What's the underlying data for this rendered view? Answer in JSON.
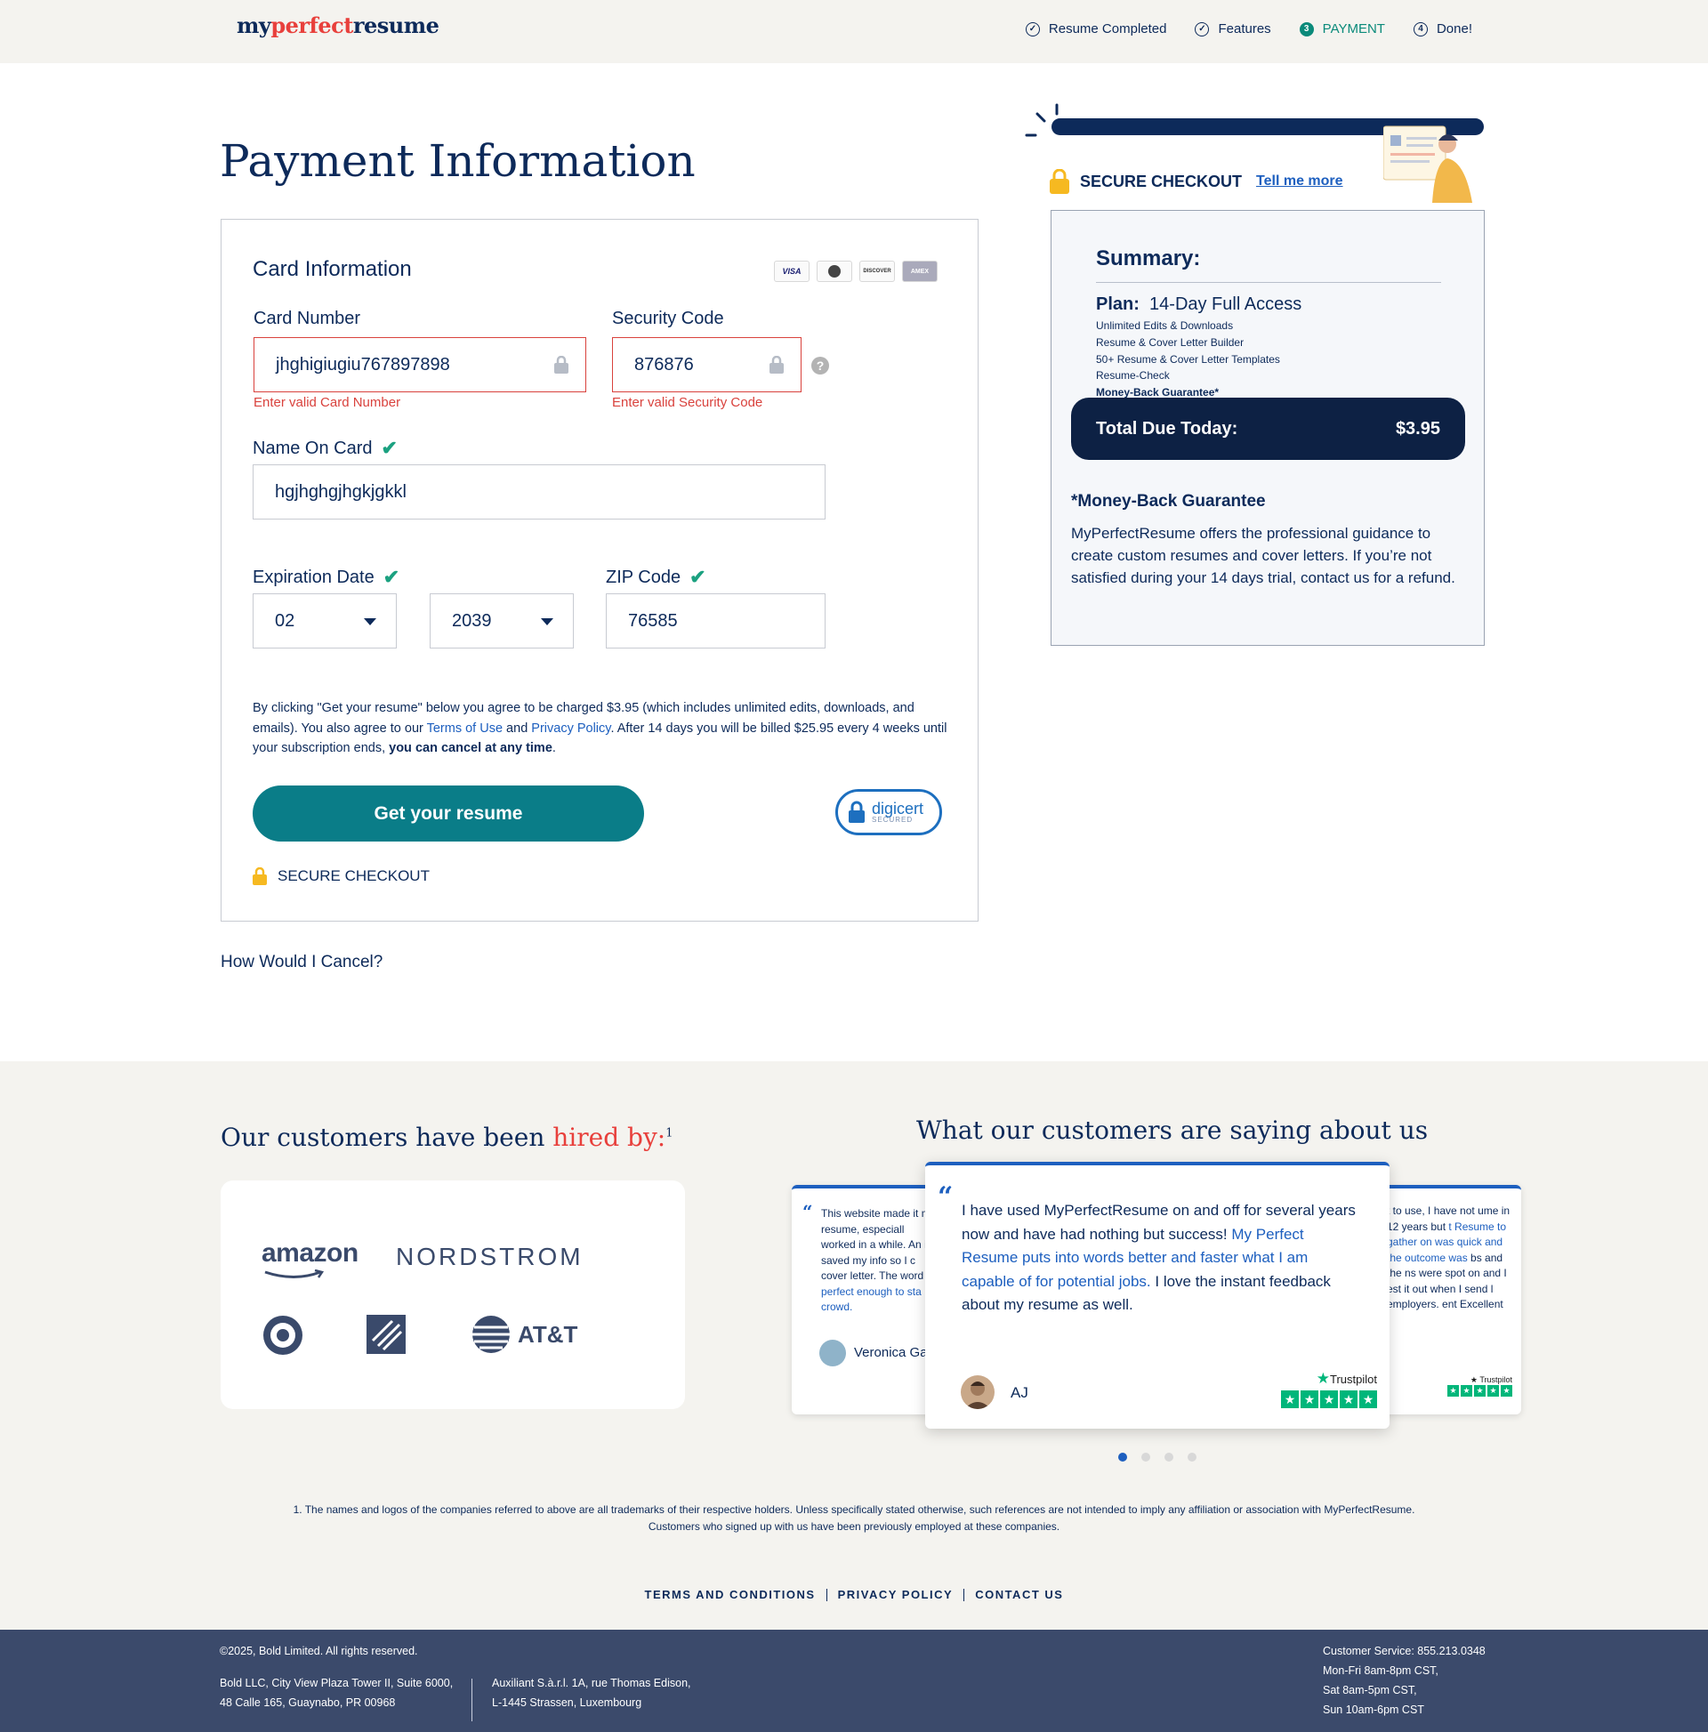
{
  "header": {
    "logo": {
      "part1": "my",
      "part2": "perfect",
      "part3": "resume"
    },
    "steps": [
      {
        "label": "Resume Completed",
        "marker": "✓",
        "active": false
      },
      {
        "label": "Features",
        "marker": "✓",
        "active": false
      },
      {
        "label": "PAYMENT",
        "marker": "3",
        "active": true
      },
      {
        "label": "Done!",
        "marker": "4",
        "active": false
      }
    ]
  },
  "form": {
    "title": "Payment Information",
    "card_heading": "Card Information",
    "card_logos": [
      "VISA",
      "MC",
      "DISCOVER",
      "AMEX"
    ],
    "card_number": {
      "label": "Card Number",
      "value": "jhghigiugiu767897898",
      "error": "Enter valid Card Number"
    },
    "security_code": {
      "label": "Security Code",
      "value": "876876",
      "error": "Enter valid Security Code",
      "help": "?"
    },
    "name_on_card": {
      "label": "Name On Card",
      "value": "hgjhghgjhgkjgkkl"
    },
    "expiration": {
      "label": "Expiration Date",
      "month": "02",
      "year": "2039"
    },
    "zip": {
      "label": "ZIP Code",
      "value": "76585"
    },
    "terms": {
      "part1": "By clicking \"Get your resume\" below you agree to be charged $3.95 (which includes unlimited edits, downloads, and emails). You also agree to our ",
      "terms_link": "Terms of Use",
      "and": " and ",
      "privacy_link": "Privacy Policy",
      "part2": ". After 14 days you will be billed $25.95 every 4 weeks until your subscription ends, ",
      "bold": "you can cancel at any time",
      "end": "."
    },
    "submit_label": "Get your resume",
    "digicert": {
      "name": "digicert",
      "sub": "SECURED"
    },
    "secure_label": "SECURE CHECKOUT",
    "cancel_link": "How Would I Cancel?"
  },
  "summary_panel": {
    "secure_label": "SECURE CHECKOUT",
    "tell_more": "Tell me more",
    "title": "Summary:",
    "plan_label": "Plan:",
    "plan_name": "14-Day Full Access",
    "features": [
      "Unlimited Edits & Downloads",
      "Resume & Cover Letter Builder",
      "50+ Resume & Cover Letter Templates",
      "Resume-Check",
      "Money-Back Guarantee*"
    ],
    "total_label": "Total Due Today:",
    "total_value": "$3.95",
    "guarantee_title": "*Money-Back Guarantee",
    "guarantee_text": "MyPerfectResume offers the professional guidance to create custom resumes and cover letters. If you’re not satisfied during your 14 days trial, contact us for a refund."
  },
  "hired": {
    "title_part1": "Our customers have been ",
    "title_part2": "hired by:",
    "footnote_mark": "1",
    "brands": [
      "amazon",
      "NORDSTROM",
      "AT&T"
    ]
  },
  "reviews": {
    "title": "What our customers are saying about us",
    "main": {
      "quote_mark": "“",
      "text_part1": "I have used MyPerfectResume on and off for several years now and have had nothing but success! ",
      "text_blue": "My Perfect Resume puts into words better and faster what I am capable of for potential jobs.",
      "text_part2": " I love the instant feedback about my resume as well.",
      "author": "AJ",
      "source": "Trustpilot"
    },
    "left": {
      "quote_mark": "“",
      "text_part1": "This website made it my resume, especiall worked in a while. An it saved my info so I c cover letter. The word ",
      "text_blue": "perfect enough to sta crowd.",
      "author": "Veronica Ga"
    },
    "right": {
      "text_part1": "t to use, I have not ume in 12 years but ",
      "text_blue": "t Resume to gather on was quick and the outcome was",
      "text_part2": " bs and the ns were spot on and I est it out when I send l employers. ent Excellent",
      "source": "Trustpilot"
    },
    "dots": [
      true,
      false,
      false,
      false
    ]
  },
  "disclaimer": {
    "line1": "1. The names and logos of the companies referred to above are all trademarks of their respective holders. Unless specifically stated otherwise, such references are not intended to imply any affiliation or association with MyPerfectResume.",
    "line2": "Customers who signed up with us have been previously employed at these companies."
  },
  "footer_links": [
    "TERMS AND CONDITIONS",
    "PRIVACY POLICY",
    "CONTACT US"
  ],
  "footer": {
    "copyright": "©2025, Bold Limited. All rights reserved.",
    "addr1_line1": "Bold LLC, City View Plaza Tower II, Suite 6000,",
    "addr1_line2": "48 Calle 165, Guaynabo, PR 00968",
    "addr2_line1": "Auxiliant S.à.r.l. 1A, rue Thomas Edison,",
    "addr2_line2": "L-1445 Strassen, Luxembourg",
    "cs_line1": "Customer Service: 855.213.0348",
    "cs_line2": "Mon-Fri 8am-8pm CST,",
    "cs_line3": "Sat 8am-5pm CST,",
    "cs_line4": "Sun 10am-6pm CST"
  },
  "colors": {
    "navy": "#0d2a5a",
    "teal_button": "#0a7d88",
    "error": "#d9423d",
    "check": "#1ba180",
    "accent_red": "#e8403c",
    "trustpilot": "#00b67a"
  }
}
